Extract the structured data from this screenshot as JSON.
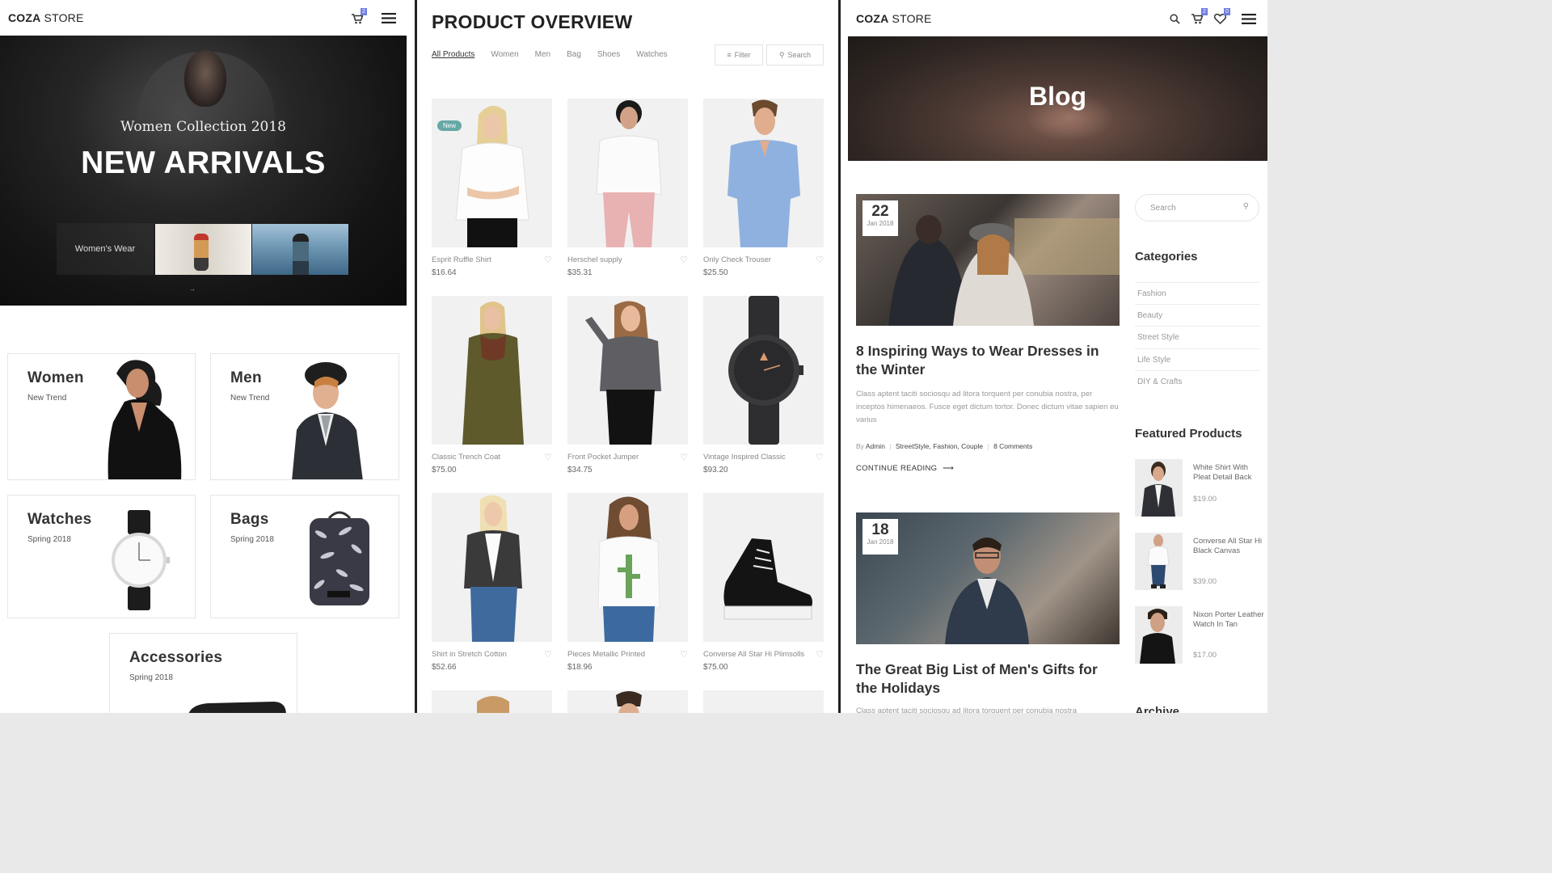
{
  "left": {
    "logo_bold": "COZA",
    "logo_rest": " STORE",
    "cart_count": "2",
    "hero": {
      "subtitle": "Women Collection 2018",
      "title": "NEW ARRIVALS",
      "thumb_label": "Women's Wear"
    },
    "categories": [
      {
        "title": "Women",
        "sub": "New Trend"
      },
      {
        "title": "Men",
        "sub": "New Trend"
      },
      {
        "title": "Watches",
        "sub": "Spring 2018"
      },
      {
        "title": "Bags",
        "sub": "Spring 2018"
      },
      {
        "title": "Accessories",
        "sub": "Spring 2018"
      }
    ]
  },
  "middle": {
    "title": "PRODUCT OVERVIEW",
    "filters": [
      "All Products",
      "Women",
      "Men",
      "Bag",
      "Shoes",
      "Watches"
    ],
    "filter_btn": "Filter",
    "search_btn": "Search",
    "new_badge": "New",
    "products": [
      {
        "name": "Esprit Ruffle Shirt",
        "price": "$16.64"
      },
      {
        "name": "Herschel supply",
        "price": "$35.31"
      },
      {
        "name": "Only Check Trouser",
        "price": "$25.50"
      },
      {
        "name": "Classic Trench Coat",
        "price": "$75.00"
      },
      {
        "name": "Front Pocket Jumper",
        "price": "$34.75"
      },
      {
        "name": "Vintage Inspired Classic",
        "price": "$93.20"
      },
      {
        "name": "Shirt in Stretch Cotton",
        "price": "$52.66"
      },
      {
        "name": "Pieces Metallic Printed",
        "price": "$18.96"
      },
      {
        "name": "Converse All Star Hi Plimsolls",
        "price": "$75.00"
      }
    ]
  },
  "right": {
    "logo_bold": "COZA",
    "logo_rest": " STORE",
    "cart_count": "2",
    "wishlist_count": "0",
    "hero_title": "Blog",
    "posts": [
      {
        "day": "22",
        "month": "Jan 2018",
        "title": "8 Inspiring Ways to Wear Dresses in the Winter",
        "excerpt": "Class aptent taciti sociosqu ad litora torquent per conubia nostra, per inceptos himenaeos. Fusce eget dictum tortor. Donec dictum vitae sapien eu varius",
        "by": "By",
        "author": "Admin",
        "tags": "StreetStyle, Fashion, Couple",
        "comments": "8 Comments",
        "continue": "CONTINUE READING"
      },
      {
        "day": "18",
        "month": "Jan 2018",
        "title": "The Great Big List of Men's Gifts for the Holidays",
        "excerpt": "Class aptent taciti sociosqu ad litora torquent per conubia nostra"
      }
    ],
    "search_placeholder": "Search",
    "categories_title": "Categories",
    "categories": [
      "Fashion",
      "Beauty",
      "Street Style",
      "Life Style",
      "DIY & Crafts"
    ],
    "featured_title": "Featured Products",
    "featured": [
      {
        "name": "White Shirt With Pleat Detail Back",
        "price": "$19.00"
      },
      {
        "name": "Converse All Star Hi Black Canvas",
        "price": "$39.00"
      },
      {
        "name": "Nixon Porter Leather Watch In Tan",
        "price": "$17.00"
      }
    ],
    "cut_off_heading": "Archive"
  }
}
